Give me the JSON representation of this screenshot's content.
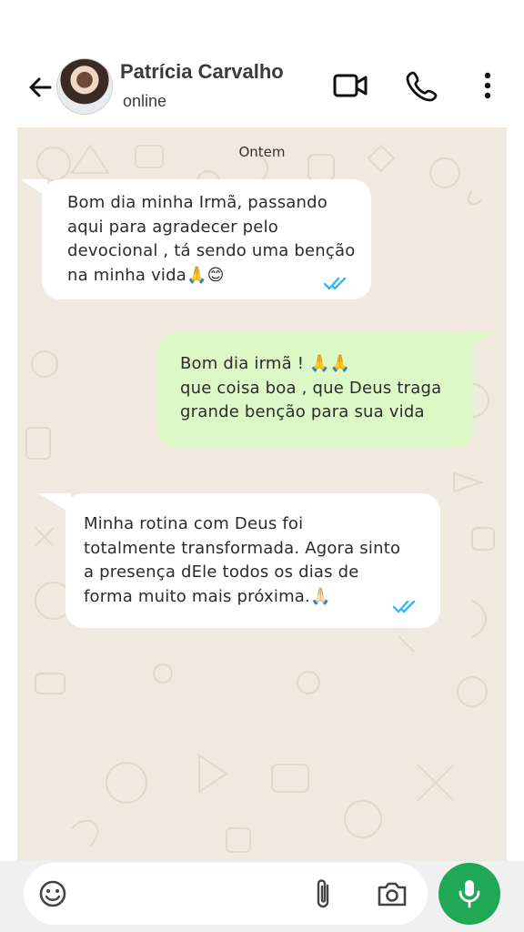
{
  "header": {
    "contact_name": "Patrícia Carvalho",
    "status": "online",
    "icons": [
      "back-arrow-icon",
      "video-call-icon",
      "phone-icon",
      "more-options-icon"
    ]
  },
  "chat": {
    "date_label": "Ontem",
    "messages": [
      {
        "direction": "received",
        "text": "Bom dia minha Irmã,  passando\naqui para agradecer pelo\ndevocional , tá sendo uma benção\nna minha vida🙏😊",
        "read": true
      },
      {
        "direction": "sent",
        "text": "Bom dia irmã ! 🙏🙏\nque coisa boa , que Deus traga\ngrande benção para sua vida"
      },
      {
        "direction": "received",
        "text": "Minha rotina com Deus foi\ntotalmente transformada. Agora sinto\na presença dEle todos os dias de\nforma muito mais próxima.🙏🏻",
        "read": true
      }
    ]
  },
  "composer": {
    "icons": [
      "emoji-icon",
      "attachment-icon",
      "camera-icon",
      "microphone-icon"
    ]
  },
  "colors": {
    "chat_background": "#efe9df",
    "sent_bubble": "#dcf8c6",
    "received_bubble": "#ffffff",
    "mic_button": "#1fa855",
    "read_ticks": "#34b7f1"
  }
}
